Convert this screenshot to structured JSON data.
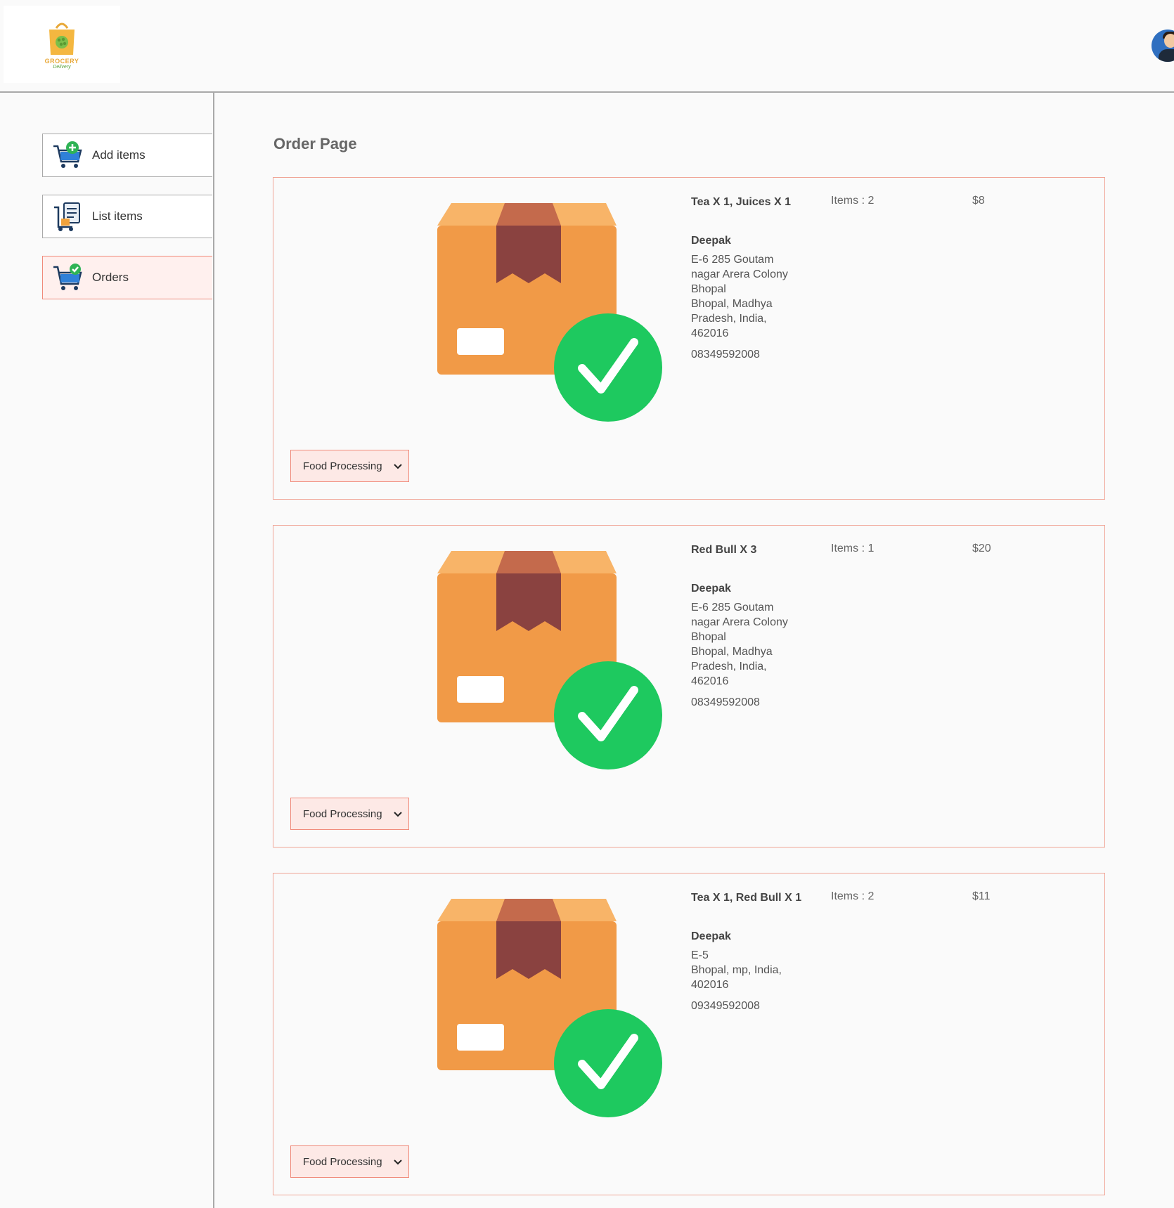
{
  "brand": {
    "logo_text": "GROCERY",
    "logo_sub": "Delivery"
  },
  "sidebar": {
    "items": [
      {
        "label": "Add items",
        "icon": "cart-add-icon"
      },
      {
        "label": "List items",
        "icon": "list-clipboard-icon"
      },
      {
        "label": "Orders",
        "icon": "cart-check-icon",
        "active": true
      }
    ]
  },
  "main": {
    "title": "Order Page"
  },
  "orders": [
    {
      "items": "Tea X 1, Juices X 1",
      "count": "Items : 2",
      "amount": "$8",
      "customer": "Deepak",
      "address": [
        "E-6 285 Goutam",
        "nagar Arera Colony",
        "Bhopal",
        "Bhopal, Madhya",
        "Pradesh, India,",
        "462016"
      ],
      "phone": "08349592008",
      "status": "Food Processing"
    },
    {
      "items": "Red Bull X 3",
      "count": "Items : 1",
      "amount": "$20",
      "customer": "Deepak",
      "address": [
        "E-6 285 Goutam",
        "nagar Arera Colony",
        "Bhopal",
        "Bhopal, Madhya",
        "Pradesh, India,",
        "462016"
      ],
      "phone": "08349592008",
      "status": "Food Processing"
    },
    {
      "items": "Tea X 1, Red Bull X 1",
      "count": "Items : 2",
      "amount": "$11",
      "customer": "Deepak",
      "address": [
        "E-5",
        "Bhopal, mp, India,",
        "402016"
      ],
      "phone": "09349592008",
      "status": "Food Processing"
    }
  ],
  "colors": {
    "accent_border": "#f08a7a",
    "accent_bg": "#fde9e6",
    "check_green": "#1ec95f",
    "box_orange": "#f19a47"
  }
}
